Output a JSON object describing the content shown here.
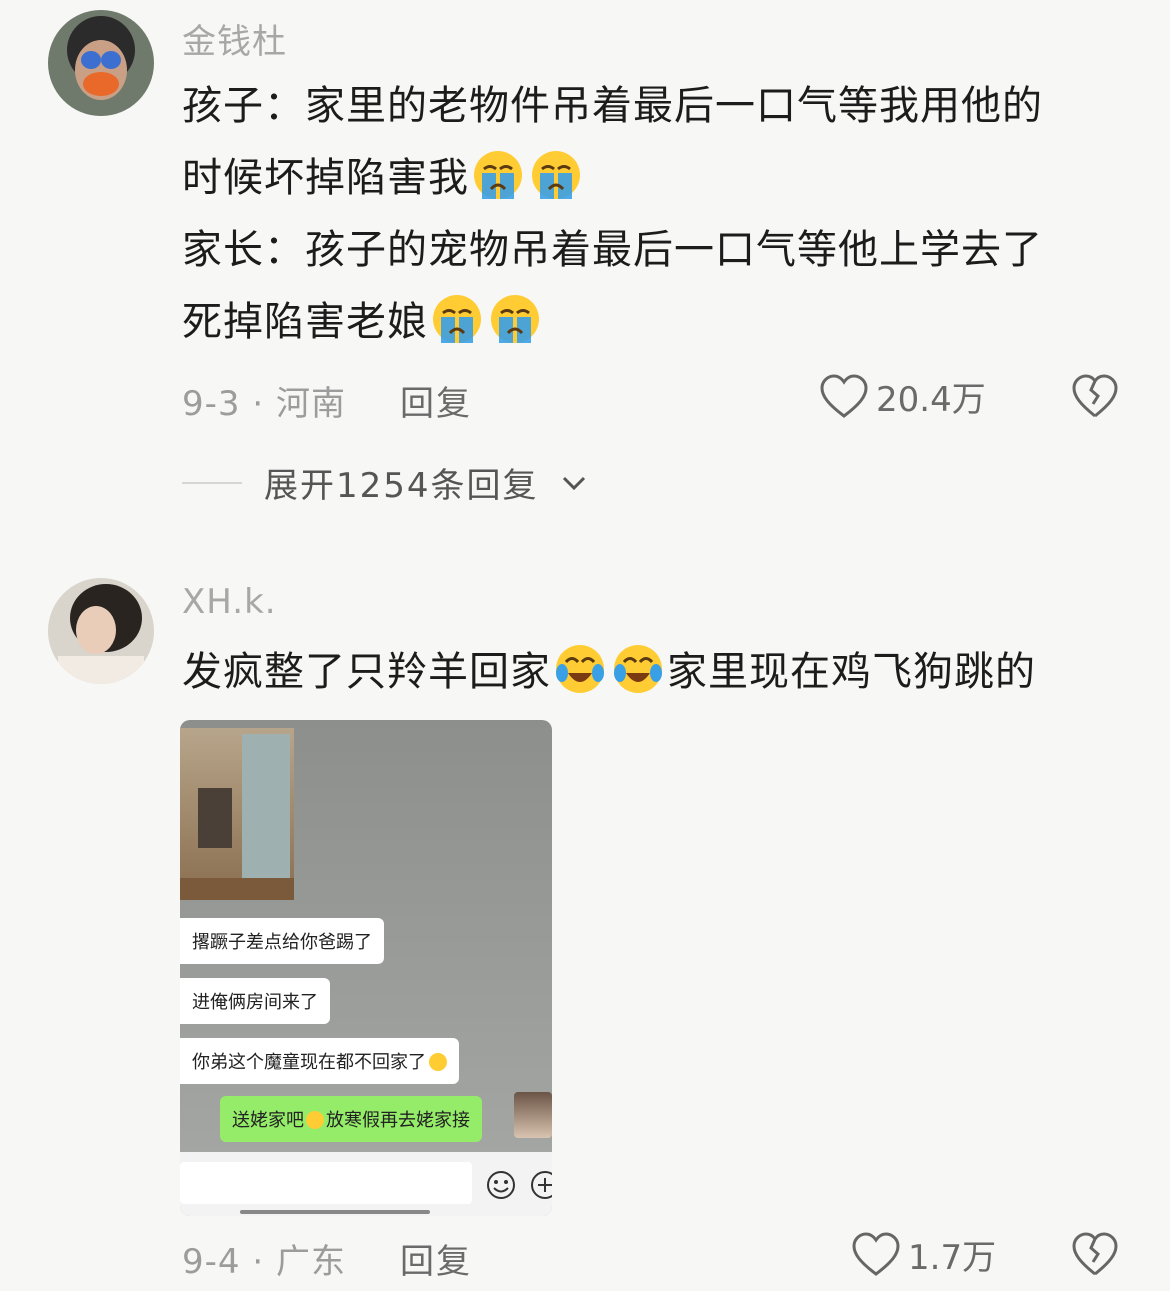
{
  "comments": [
    {
      "username": "金钱杜",
      "lines": [
        {
          "text": "孩子：家里的老物件吊着最后一口气等我用他的"
        },
        {
          "text": "时候坏掉陷害我",
          "emoji": "crying-face",
          "emoji_count": 2
        },
        {
          "text": "家长：孩子的宠物吊着最后一口气等他上学去了"
        },
        {
          "text": "死掉陷害老娘",
          "emoji": "crying-face",
          "emoji_count": 2
        }
      ],
      "date_location": "9-3 · 河南",
      "reply_label": "回复",
      "like_count": "20.4万"
    },
    {
      "username": "XH.k.",
      "line_before": "发疯整了只羚羊回家",
      "emoji": "tears-of-joy-face",
      "emoji_count": 2,
      "line_after": "家里现在鸡飞狗跳的",
      "date_location": "9-4 · 广东",
      "reply_label": "回复",
      "like_count": "1.7万"
    }
  ],
  "expand_replies": "展开1254条回复",
  "screenshot": {
    "messages": [
      "撂蹶子差点给你爸踢了",
      "进俺俩房间来了",
      "你弟这个魔童现在都不回家了"
    ],
    "my_message_before": "送姥家吧",
    "my_message_after": "放寒假再去姥家接"
  },
  "colors": {
    "accent_green": "#95ec69",
    "emoji_yellow": "#ffcc33",
    "tear_blue": "#3aa0e6"
  }
}
